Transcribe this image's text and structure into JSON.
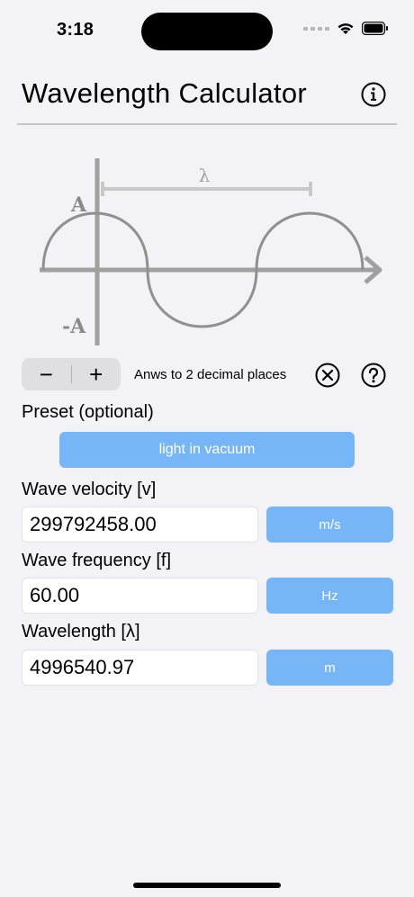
{
  "status": {
    "time": "3:18"
  },
  "header": {
    "title": "Wavelength Calculator",
    "info_icon": "info-circle-icon"
  },
  "diagram": {
    "lambda_label": "λ",
    "amplitude_label": "A",
    "neg_amplitude_label": "-A"
  },
  "controls": {
    "decrement_label": "−",
    "increment_label": "+",
    "decimals_text": "Anws to 2 decimal places",
    "clear_icon": "clear-circle-icon",
    "help_icon": "question-circle-icon"
  },
  "preset": {
    "label": "Preset (optional)",
    "value": "light in vacuum"
  },
  "fields": {
    "velocity": {
      "label": "Wave velocity [v]",
      "value": "299792458.00",
      "unit": "m/s"
    },
    "frequency": {
      "label": "Wave frequency [f]",
      "value": "60.00",
      "unit": "Hz"
    },
    "wavelength": {
      "label": "Wavelength [λ]",
      "value": "4996540.97",
      "unit": "m"
    }
  },
  "colors": {
    "accent_button": "#76b6f7",
    "background": "#f2f2f7",
    "diagram_gray": "#a0a0a0"
  }
}
